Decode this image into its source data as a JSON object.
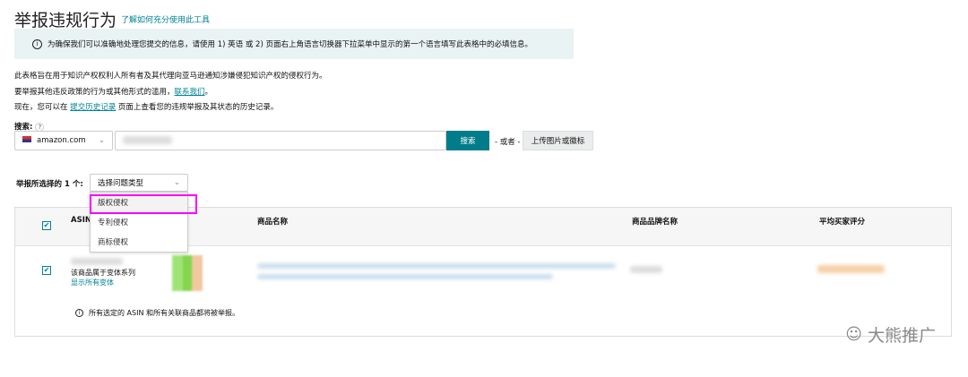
{
  "header": {
    "title": "举报违规行为",
    "learn_link": "了解如何充分使用此工具"
  },
  "banner": {
    "text": "为确保我们可以准确地处理您提交的信息，请使用 1) 英语 或 2) 页面右上角语言切换器下拉菜单中显示的第一个语言填写此表格中的必填信息。"
  },
  "intro": {
    "line1": "此表格旨在用于知识产权权利人所有者及其代理向亚马逊通知涉嫌侵犯知识产权的侵权行为。",
    "line2_pre": "要举报其他违反政策的行为或其他形式的滥用，",
    "line2_link": "联系我们",
    "line2_post": "。",
    "line3_pre": "现在，您可以在 ",
    "line3_link": "提交历史记录",
    "line3_post": " 页面上查看您的违规举报及其状态的历史记录。"
  },
  "search": {
    "label": "搜索:",
    "help": "?",
    "marketplace": "amazon.com",
    "button": "搜索",
    "or": "- 或者 -",
    "upload": "上传图片或徽标"
  },
  "report": {
    "label": "举报所选择的 1 个:",
    "select_placeholder": "选择问题类型",
    "options": [
      "版权侵权",
      "专利侵权",
      "商标侵权"
    ]
  },
  "table": {
    "headers": [
      "ASIN",
      "商品名称",
      "商品品牌名称",
      "平均买家评分"
    ],
    "row": {
      "variant_text": "该商品属于变体系列",
      "variant_link": "显示所有变体"
    },
    "note": "所有选定的 ASIN 和所有关联商品都将被举报。"
  },
  "watermark": "大熊推广"
}
